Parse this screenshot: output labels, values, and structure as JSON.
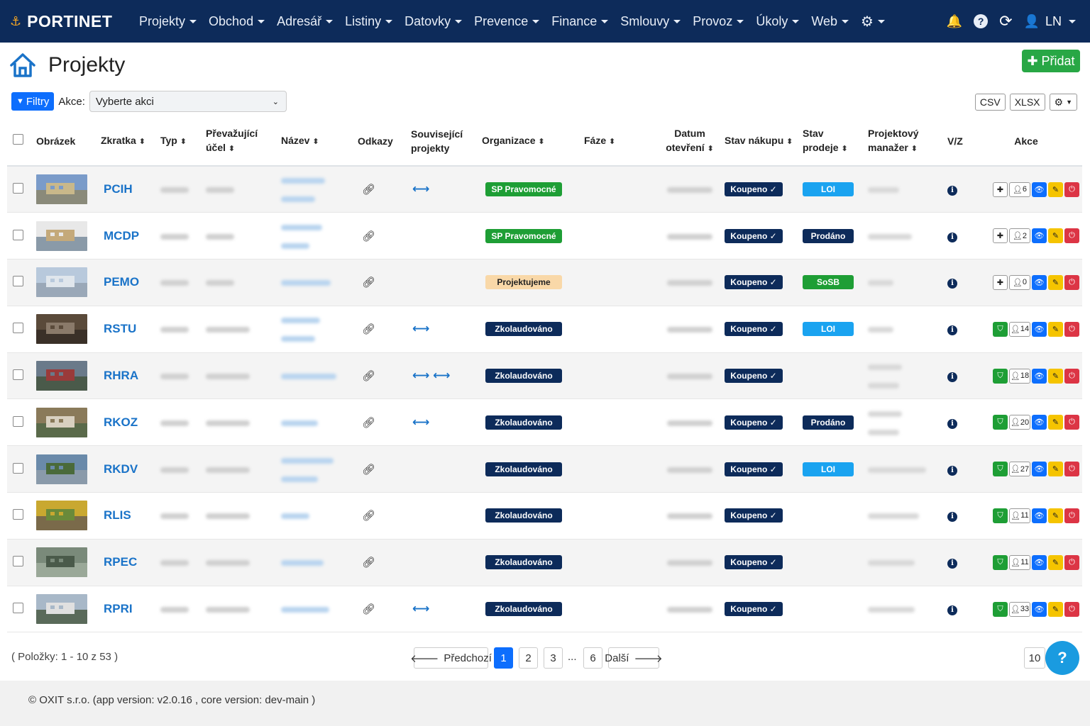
{
  "nav": {
    "brand": "PORTINET",
    "items": [
      "Projekty",
      "Obchod",
      "Adresář",
      "Listiny",
      "Datovky",
      "Prevence",
      "Finance",
      "Smlouvy",
      "Provoz",
      "Úkoly",
      "Web"
    ],
    "user": "LN"
  },
  "page": {
    "title": "Projekty",
    "add_label": "Přidat"
  },
  "toolbar": {
    "filters_label": "Filtry",
    "action_label": "Akce:",
    "action_select": "Vyberte akci",
    "csv": "CSV",
    "xlsx": "XLSX"
  },
  "table": {
    "columns": {
      "image": "Obrázek",
      "code": "Zkratka",
      "type": "Typ",
      "purpose": "Převažující účel",
      "name": "Název",
      "links": "Odkazy",
      "related": "Související projekty",
      "org": "Organizace",
      "phase": "Fáze",
      "opened": "Datum otevření",
      "purchase": "Stav nákupu",
      "sale": "Stav prodeje",
      "pm": "Projektový manažer",
      "vz": "V/Z",
      "actions": "Akce"
    },
    "rows": [
      {
        "code": "PCIH",
        "org": "SP Pravomocné",
        "org_color": "#1e9e35",
        "purchase": "Koupeno ✓",
        "sale": "LOI",
        "sale_color": "#1aa3f0",
        "count": "6",
        "related": "⟷",
        "first_action": "plus"
      },
      {
        "code": "MCDP",
        "org": "SP Pravomocné",
        "org_color": "#1e9e35",
        "purchase": "Koupeno ✓",
        "sale": "Prodáno",
        "sale_color": "#0d2b5a",
        "count": "2",
        "related": "",
        "first_action": "plus"
      },
      {
        "code": "PEMO",
        "org": "Projektujeme",
        "org_color": "#f9d8a8",
        "purchase": "Koupeno ✓",
        "sale": "SoSB",
        "sale_color": "#1e9e35",
        "count": "0",
        "related": "",
        "first_action": "plus"
      },
      {
        "code": "RSTU",
        "org": "Zkolaudováno",
        "org_color": "#0d2b5a",
        "purchase": "Koupeno ✓",
        "sale": "LOI",
        "sale_color": "#1aa3f0",
        "count": "14",
        "related": "⟷",
        "first_action": "shield"
      },
      {
        "code": "RHRA",
        "org": "Zkolaudováno",
        "org_color": "#0d2b5a",
        "purchase": "Koupeno ✓",
        "sale": "",
        "sale_color": "",
        "count": "18",
        "related": "⟷ ⟷",
        "first_action": "shield"
      },
      {
        "code": "RKOZ",
        "org": "Zkolaudováno",
        "org_color": "#0d2b5a",
        "purchase": "Koupeno ✓",
        "sale": "Prodáno",
        "sale_color": "#0d2b5a",
        "count": "20",
        "related": "⟷",
        "first_action": "shield"
      },
      {
        "code": "RKDV",
        "org": "Zkolaudováno",
        "org_color": "#0d2b5a",
        "purchase": "Koupeno ✓",
        "sale": "LOI",
        "sale_color": "#1aa3f0",
        "count": "27",
        "related": "",
        "first_action": "shield"
      },
      {
        "code": "RLIS",
        "org": "Zkolaudováno",
        "org_color": "#0d2b5a",
        "purchase": "Koupeno ✓",
        "sale": "",
        "sale_color": "",
        "count": "11",
        "related": "",
        "first_action": "shield"
      },
      {
        "code": "RPEC",
        "org": "Zkolaudováno",
        "org_color": "#0d2b5a",
        "purchase": "Koupeno ✓",
        "sale": "",
        "sale_color": "",
        "count": "11",
        "related": "",
        "first_action": "shield"
      },
      {
        "code": "RPRI",
        "org": "Zkolaudováno",
        "org_color": "#0d2b5a",
        "purchase": "Koupeno ✓",
        "sale": "",
        "sale_color": "",
        "count": "33",
        "related": "⟷",
        "first_action": "shield"
      }
    ]
  },
  "pagination": {
    "summary": "( Položky: 1 - 10 z 53 )",
    "prev": "Předchozí",
    "next": "Další",
    "pages": [
      "1",
      "2",
      "3",
      "...",
      "6"
    ],
    "current": "1",
    "per_page": "10"
  },
  "footer": {
    "text": "© OXIT s.r.o. (app version: v2.0.16 , core version: dev-main )"
  }
}
